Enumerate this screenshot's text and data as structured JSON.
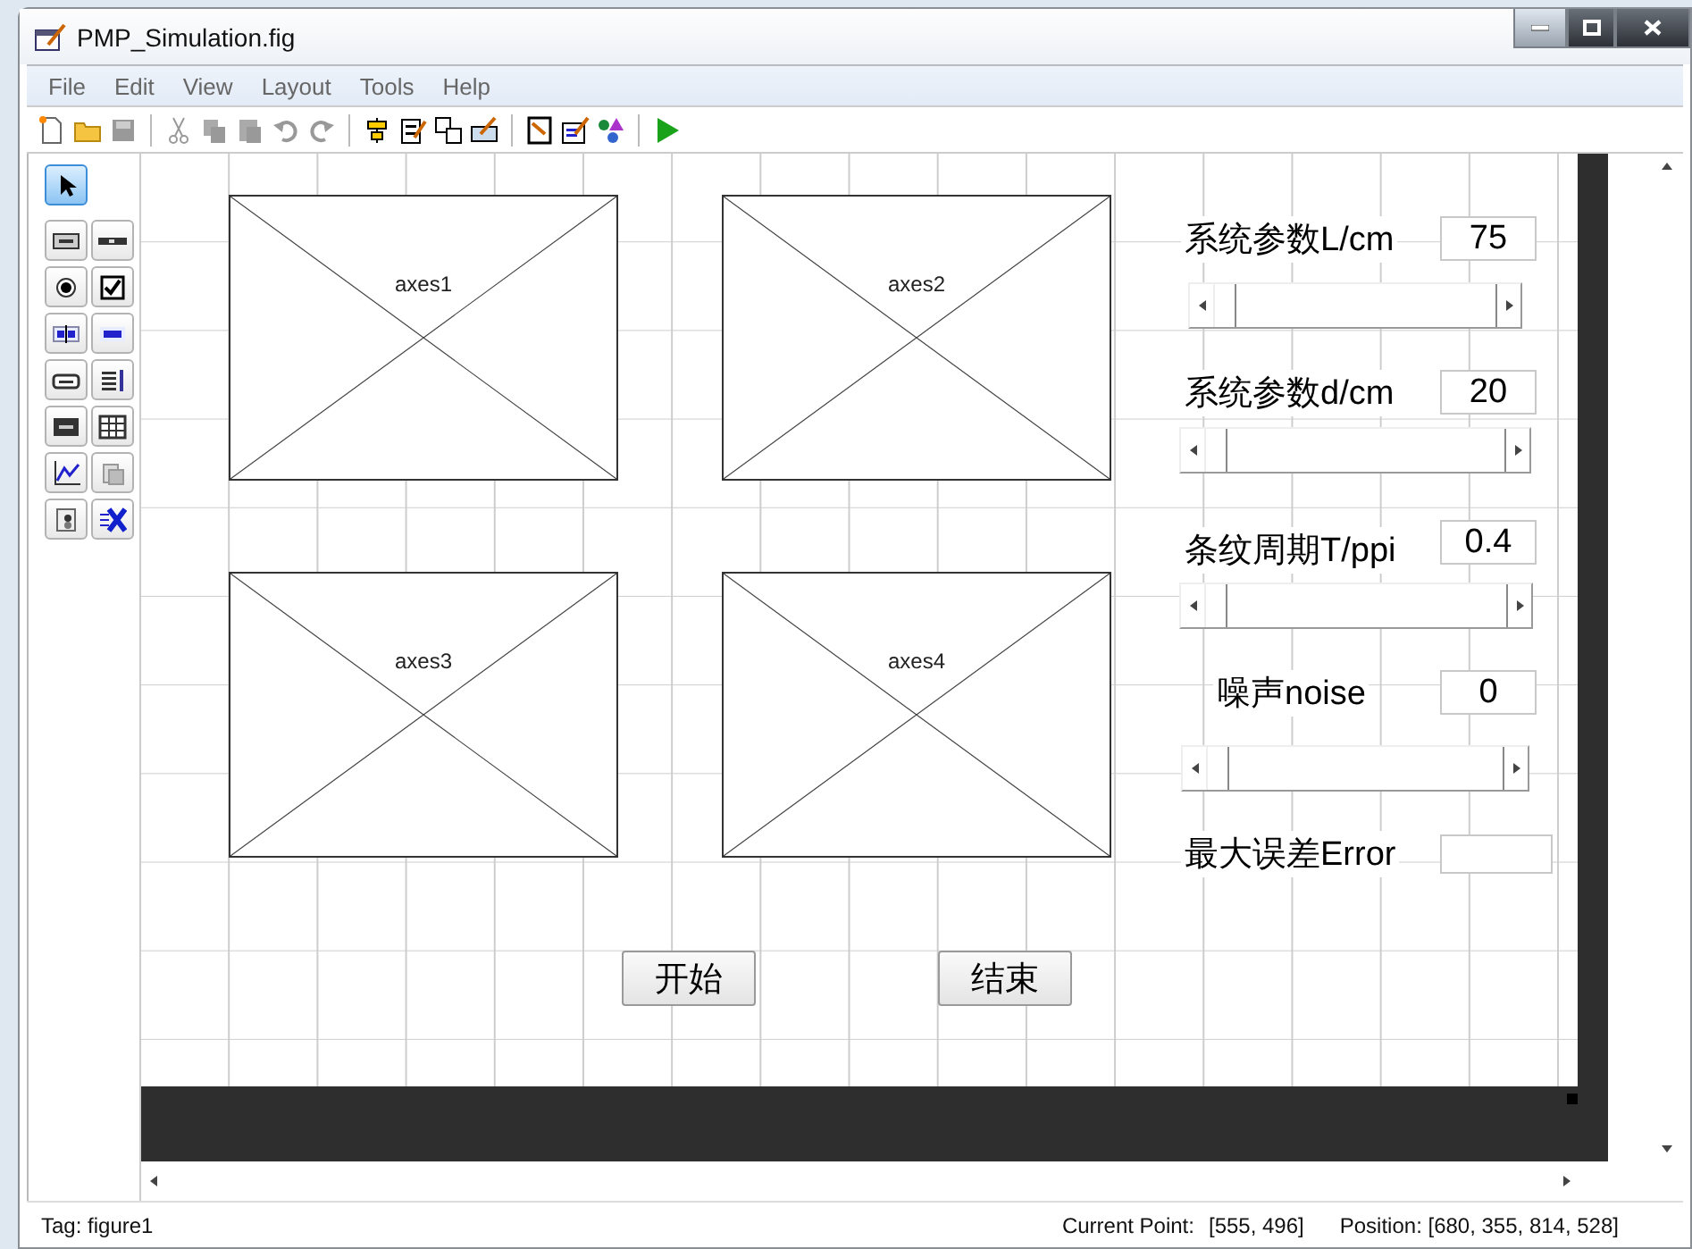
{
  "window": {
    "title": "PMP_Simulation.fig"
  },
  "menu": [
    "File",
    "Edit",
    "View",
    "Layout",
    "Tools",
    "Help"
  ],
  "palette": [
    {
      "kind": "select",
      "selected": true
    },
    {
      "kind": "pushbutton",
      "selected": false
    },
    {
      "kind": "slider",
      "selected": false
    },
    {
      "kind": "radio",
      "selected": false
    },
    {
      "kind": "checkbox",
      "selected": false
    },
    {
      "kind": "edit",
      "selected": false
    },
    {
      "kind": "text",
      "selected": false
    },
    {
      "kind": "popup",
      "selected": false
    },
    {
      "kind": "listbox",
      "selected": false
    },
    {
      "kind": "toggle",
      "selected": false
    },
    {
      "kind": "table",
      "selected": false
    },
    {
      "kind": "axes",
      "selected": false
    },
    {
      "kind": "panel",
      "selected": false
    },
    {
      "kind": "buttongroup",
      "selected": false
    },
    {
      "kind": "activex",
      "selected": false
    }
  ],
  "axes": [
    "axes1",
    "axes2",
    "axes3",
    "axes4"
  ],
  "params": [
    {
      "label": "系统参数L/cm",
      "value": "75",
      "level": 0
    },
    {
      "label": "系统参数d/cm",
      "value": "20",
      "level": 0
    },
    {
      "label": "条纹周期T/ppi",
      "value": "0.4",
      "level": 0
    },
    {
      "label": "噪声noise",
      "value": "0",
      "level": 0
    }
  ],
  "error": {
    "label": "最大误差Error"
  },
  "buttons": [
    "开始",
    "结束"
  ],
  "status_bar": {
    "tag": "Tag: figure1",
    "current_point_label": "Current Point:",
    "current_point": "[555, 496]",
    "position": "Position: [680, 355, 814, 528]"
  }
}
